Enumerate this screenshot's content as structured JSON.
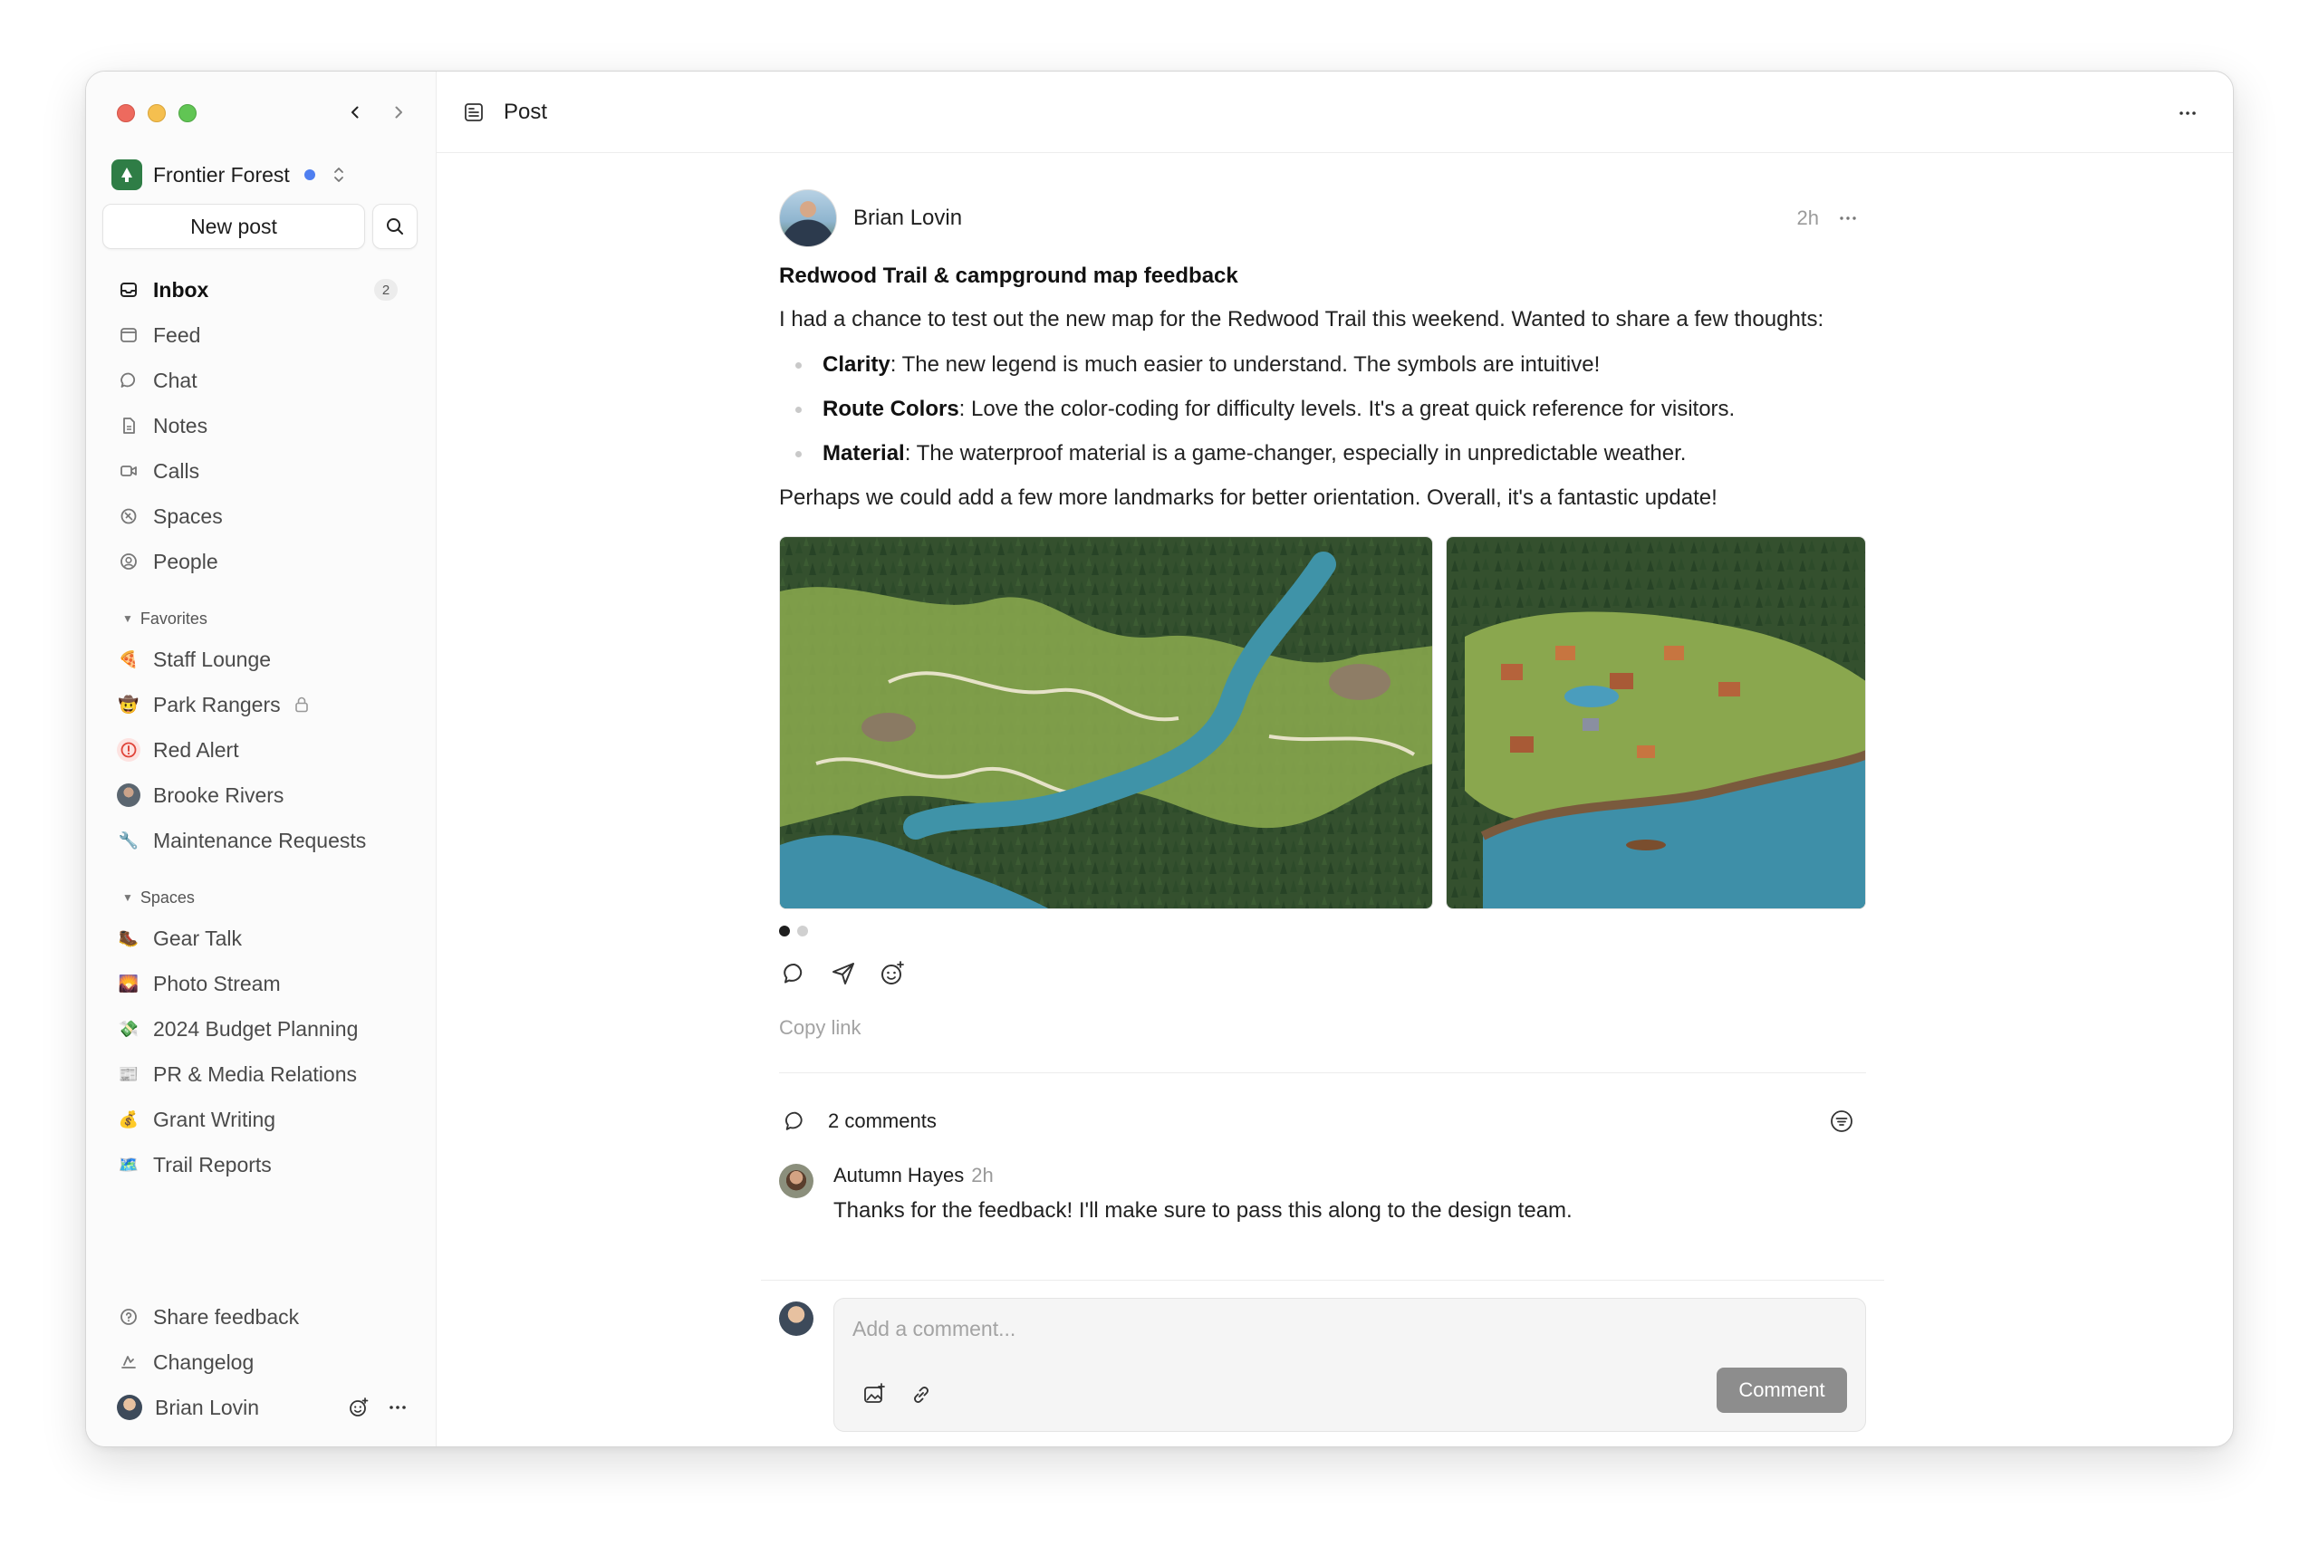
{
  "sidebar": {
    "org": {
      "name": "Frontier Forest"
    },
    "new_post_label": "New post",
    "nav": [
      {
        "label": "Inbox",
        "icon": "inbox-icon",
        "badge": "2"
      },
      {
        "label": "Feed",
        "icon": "feed-icon"
      },
      {
        "label": "Chat",
        "icon": "chat-icon"
      },
      {
        "label": "Notes",
        "icon": "notes-icon"
      },
      {
        "label": "Calls",
        "icon": "video-icon"
      },
      {
        "label": "Spaces",
        "icon": "spaces-icon"
      },
      {
        "label": "People",
        "icon": "people-icon"
      }
    ],
    "favorites": {
      "title": "Favorites",
      "items": [
        {
          "label": "Staff Lounge",
          "emoji": "🍕"
        },
        {
          "label": "Park Rangers",
          "emoji": "🤠"
        },
        {
          "label": "Red Alert",
          "emoji": "❗"
        },
        {
          "label": "Brooke Rivers",
          "emoji": ""
        },
        {
          "label": "Maintenance Requests",
          "emoji": "🔧"
        }
      ]
    },
    "spaces": {
      "title": "Spaces",
      "items": [
        {
          "label": "Gear Talk",
          "emoji": "🥾"
        },
        {
          "label": "Photo Stream",
          "emoji": "🌄"
        },
        {
          "label": "2024 Budget Planning",
          "emoji": "💸"
        },
        {
          "label": "PR & Media Relations",
          "emoji": "📰"
        },
        {
          "label": "Grant Writing",
          "emoji": "💰"
        },
        {
          "label": "Trail Reports",
          "emoji": "🗺️"
        }
      ]
    },
    "bottom": {
      "share_feedback": "Share feedback",
      "changelog": "Changelog",
      "user_name": "Brian Lovin"
    }
  },
  "topbar": {
    "title": "Post"
  },
  "post": {
    "author": "Brian Lovin",
    "time": "2h",
    "title": "Redwood Trail & campground map feedback",
    "intro": "I had a chance to test out the new map for the Redwood Trail this weekend. Wanted to share a few thoughts:",
    "bullets": [
      {
        "term": "Clarity",
        "text": ": The new legend is much easier to understand. The symbols are intuitive!"
      },
      {
        "term": "Route Colors",
        "text": ": Love the color-coding for difficulty levels. It's a great quick reference for visitors."
      },
      {
        "term": "Material",
        "text": ": The waterproof material is a game-changer, especially in unpredictable weather."
      }
    ],
    "closing": "Perhaps we could add a few more landmarks for better orientation. Overall, it's a fantastic update!",
    "copy_link": "Copy link",
    "comments_count": "2 comments"
  },
  "comments": [
    {
      "author": "Autumn Hayes",
      "time": "2h",
      "text": "Thanks for the feedback! I'll make sure to pass this along to the design team."
    }
  ],
  "composer": {
    "placeholder": "Add a comment...",
    "submit_label": "Comment"
  },
  "colors": {
    "accent_blue": "#4f7ff0",
    "org_green": "#2f7d46",
    "comment_button": "#8d8d8d"
  }
}
